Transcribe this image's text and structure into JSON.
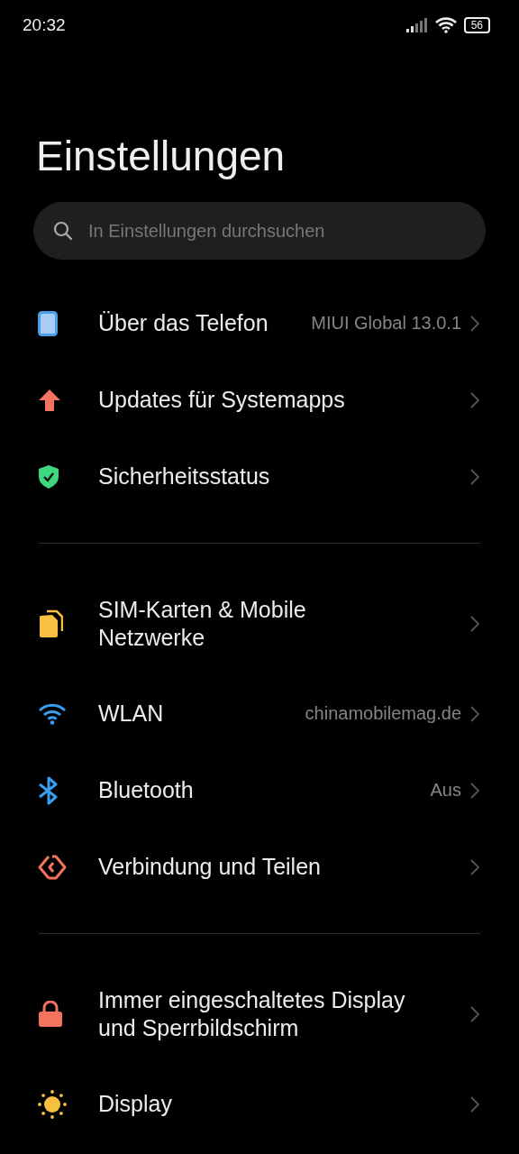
{
  "status_bar": {
    "time": "20:32",
    "battery": "56"
  },
  "title": "Einstellungen",
  "search": {
    "placeholder": "In Einstellungen durchsuchen"
  },
  "groups": [
    {
      "items": [
        {
          "label": "Über das Telefon",
          "value": "MIUI Global 13.0.1"
        },
        {
          "label": "Updates für Systemapps"
        },
        {
          "label": "Sicherheitsstatus"
        }
      ]
    },
    {
      "items": [
        {
          "label": "SIM-Karten & Mobile\nNetzwerke"
        },
        {
          "label": "WLAN",
          "value": "chinamobilemag.de"
        },
        {
          "label": "Bluetooth",
          "value": "Aus"
        },
        {
          "label": "Verbindung und Teilen"
        }
      ]
    },
    {
      "items": [
        {
          "label": "Immer eingeschaltetes Display\nund Sperrbildschirm"
        },
        {
          "label": "Display"
        }
      ]
    }
  ]
}
